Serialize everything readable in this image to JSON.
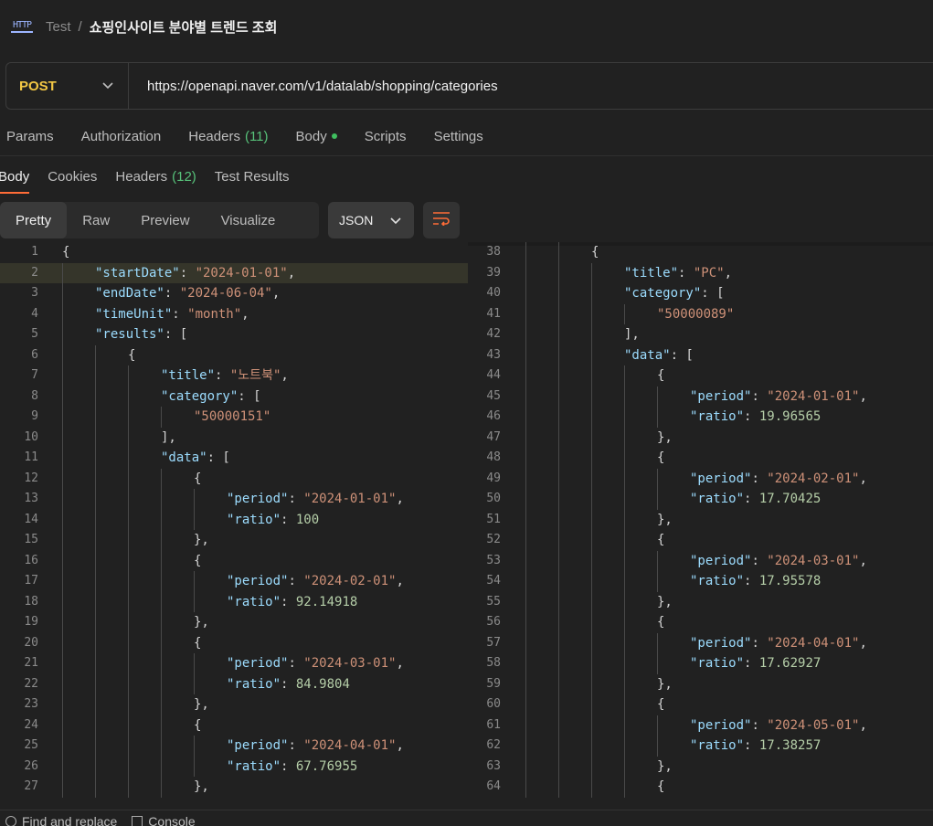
{
  "breadcrumb": {
    "parent": "Test",
    "separator": "/",
    "title": "쇼핑인사이트 분야별 트렌드 조회"
  },
  "request": {
    "method": "POST",
    "url": "https://openapi.naver.com/v1/datalab/shopping/categories"
  },
  "request_tabs": [
    {
      "label": "Params"
    },
    {
      "label": "Authorization"
    },
    {
      "label": "Headers",
      "count": "(11)"
    },
    {
      "label": "Body",
      "dot": true
    },
    {
      "label": "Scripts"
    },
    {
      "label": "Settings"
    }
  ],
  "response_tabs": [
    {
      "label": "Body",
      "active": true
    },
    {
      "label": "Cookies"
    },
    {
      "label": "Headers",
      "count": "(12)"
    },
    {
      "label": "Test Results"
    }
  ],
  "view_modes": [
    {
      "label": "Pretty",
      "active": true
    },
    {
      "label": "Raw"
    },
    {
      "label": "Preview"
    },
    {
      "label": "Visualize"
    }
  ],
  "format": "JSON",
  "colors": {
    "accent": "#ff6c37",
    "method": "#f2c744",
    "key": "#9cdcfe",
    "string": "#ce9178",
    "number": "#b5cea8"
  },
  "code_left": [
    {
      "n": "1",
      "indent": 0,
      "t": [
        [
          "p",
          "{"
        ]
      ]
    },
    {
      "n": "2",
      "indent": 1,
      "hl": true,
      "t": [
        [
          "k",
          "\"startDate\""
        ],
        [
          "p",
          ": "
        ],
        [
          "s",
          "\"2024-01-01\""
        ],
        [
          "p",
          ","
        ]
      ]
    },
    {
      "n": "3",
      "indent": 1,
      "t": [
        [
          "k",
          "\"endDate\""
        ],
        [
          "p",
          ": "
        ],
        [
          "s",
          "\"2024-06-04\""
        ],
        [
          "p",
          ","
        ]
      ]
    },
    {
      "n": "4",
      "indent": 1,
      "t": [
        [
          "k",
          "\"timeUnit\""
        ],
        [
          "p",
          ": "
        ],
        [
          "s",
          "\"month\""
        ],
        [
          "p",
          ","
        ]
      ]
    },
    {
      "n": "5",
      "indent": 1,
      "t": [
        [
          "k",
          "\"results\""
        ],
        [
          "p",
          ": ["
        ]
      ]
    },
    {
      "n": "6",
      "indent": 2,
      "t": [
        [
          "p",
          "{"
        ]
      ]
    },
    {
      "n": "7",
      "indent": 3,
      "t": [
        [
          "k",
          "\"title\""
        ],
        [
          "p",
          ": "
        ],
        [
          "s",
          "\"노트북\""
        ],
        [
          "p",
          ","
        ]
      ]
    },
    {
      "n": "8",
      "indent": 3,
      "t": [
        [
          "k",
          "\"category\""
        ],
        [
          "p",
          ": ["
        ]
      ]
    },
    {
      "n": "9",
      "indent": 4,
      "t": [
        [
          "s",
          "\"50000151\""
        ]
      ]
    },
    {
      "n": "10",
      "indent": 3,
      "t": [
        [
          "p",
          "],"
        ]
      ]
    },
    {
      "n": "11",
      "indent": 3,
      "t": [
        [
          "k",
          "\"data\""
        ],
        [
          "p",
          ": ["
        ]
      ]
    },
    {
      "n": "12",
      "indent": 4,
      "t": [
        [
          "p",
          "{"
        ]
      ]
    },
    {
      "n": "13",
      "indent": 5,
      "t": [
        [
          "k",
          "\"period\""
        ],
        [
          "p",
          ": "
        ],
        [
          "s",
          "\"2024-01-01\""
        ],
        [
          "p",
          ","
        ]
      ]
    },
    {
      "n": "14",
      "indent": 5,
      "t": [
        [
          "k",
          "\"ratio\""
        ],
        [
          "p",
          ": "
        ],
        [
          "n",
          "100"
        ]
      ]
    },
    {
      "n": "15",
      "indent": 4,
      "t": [
        [
          "p",
          "},"
        ]
      ]
    },
    {
      "n": "16",
      "indent": 4,
      "t": [
        [
          "p",
          "{"
        ]
      ]
    },
    {
      "n": "17",
      "indent": 5,
      "t": [
        [
          "k",
          "\"period\""
        ],
        [
          "p",
          ": "
        ],
        [
          "s",
          "\"2024-02-01\""
        ],
        [
          "p",
          ","
        ]
      ]
    },
    {
      "n": "18",
      "indent": 5,
      "t": [
        [
          "k",
          "\"ratio\""
        ],
        [
          "p",
          ": "
        ],
        [
          "n",
          "92.14918"
        ]
      ]
    },
    {
      "n": "19",
      "indent": 4,
      "t": [
        [
          "p",
          "},"
        ]
      ]
    },
    {
      "n": "20",
      "indent": 4,
      "t": [
        [
          "p",
          "{"
        ]
      ]
    },
    {
      "n": "21",
      "indent": 5,
      "t": [
        [
          "k",
          "\"period\""
        ],
        [
          "p",
          ": "
        ],
        [
          "s",
          "\"2024-03-01\""
        ],
        [
          "p",
          ","
        ]
      ]
    },
    {
      "n": "22",
      "indent": 5,
      "t": [
        [
          "k",
          "\"ratio\""
        ],
        [
          "p",
          ": "
        ],
        [
          "n",
          "84.9804"
        ]
      ]
    },
    {
      "n": "23",
      "indent": 4,
      "t": [
        [
          "p",
          "},"
        ]
      ]
    },
    {
      "n": "24",
      "indent": 4,
      "t": [
        [
          "p",
          "{"
        ]
      ]
    },
    {
      "n": "25",
      "indent": 5,
      "t": [
        [
          "k",
          "\"period\""
        ],
        [
          "p",
          ": "
        ],
        [
          "s",
          "\"2024-04-01\""
        ],
        [
          "p",
          ","
        ]
      ]
    },
    {
      "n": "26",
      "indent": 5,
      "t": [
        [
          "k",
          "\"ratio\""
        ],
        [
          "p",
          ": "
        ],
        [
          "n",
          "67.76955"
        ]
      ]
    },
    {
      "n": "27",
      "indent": 4,
      "t": [
        [
          "p",
          "},"
        ]
      ]
    }
  ],
  "code_right": [
    {
      "n": "38",
      "indent": 2,
      "t": [
        [
          "p",
          "{"
        ]
      ]
    },
    {
      "n": "39",
      "indent": 3,
      "t": [
        [
          "k",
          "\"title\""
        ],
        [
          "p",
          ": "
        ],
        [
          "s",
          "\"PC\""
        ],
        [
          "p",
          ","
        ]
      ]
    },
    {
      "n": "40",
      "indent": 3,
      "t": [
        [
          "k",
          "\"category\""
        ],
        [
          "p",
          ": ["
        ]
      ]
    },
    {
      "n": "41",
      "indent": 4,
      "t": [
        [
          "s",
          "\"50000089\""
        ]
      ]
    },
    {
      "n": "42",
      "indent": 3,
      "t": [
        [
          "p",
          "],"
        ]
      ]
    },
    {
      "n": "43",
      "indent": 3,
      "t": [
        [
          "k",
          "\"data\""
        ],
        [
          "p",
          ": ["
        ]
      ]
    },
    {
      "n": "44",
      "indent": 4,
      "t": [
        [
          "p",
          "{"
        ]
      ]
    },
    {
      "n": "45",
      "indent": 5,
      "t": [
        [
          "k",
          "\"period\""
        ],
        [
          "p",
          ": "
        ],
        [
          "s",
          "\"2024-01-01\""
        ],
        [
          "p",
          ","
        ]
      ]
    },
    {
      "n": "46",
      "indent": 5,
      "t": [
        [
          "k",
          "\"ratio\""
        ],
        [
          "p",
          ": "
        ],
        [
          "n",
          "19.96565"
        ]
      ]
    },
    {
      "n": "47",
      "indent": 4,
      "t": [
        [
          "p",
          "},"
        ]
      ]
    },
    {
      "n": "48",
      "indent": 4,
      "t": [
        [
          "p",
          "{"
        ]
      ]
    },
    {
      "n": "49",
      "indent": 5,
      "t": [
        [
          "k",
          "\"period\""
        ],
        [
          "p",
          ": "
        ],
        [
          "s",
          "\"2024-02-01\""
        ],
        [
          "p",
          ","
        ]
      ]
    },
    {
      "n": "50",
      "indent": 5,
      "t": [
        [
          "k",
          "\"ratio\""
        ],
        [
          "p",
          ": "
        ],
        [
          "n",
          "17.70425"
        ]
      ]
    },
    {
      "n": "51",
      "indent": 4,
      "t": [
        [
          "p",
          "},"
        ]
      ]
    },
    {
      "n": "52",
      "indent": 4,
      "t": [
        [
          "p",
          "{"
        ]
      ]
    },
    {
      "n": "53",
      "indent": 5,
      "t": [
        [
          "k",
          "\"period\""
        ],
        [
          "p",
          ": "
        ],
        [
          "s",
          "\"2024-03-01\""
        ],
        [
          "p",
          ","
        ]
      ]
    },
    {
      "n": "54",
      "indent": 5,
      "t": [
        [
          "k",
          "\"ratio\""
        ],
        [
          "p",
          ": "
        ],
        [
          "n",
          "17.95578"
        ]
      ]
    },
    {
      "n": "55",
      "indent": 4,
      "t": [
        [
          "p",
          "},"
        ]
      ]
    },
    {
      "n": "56",
      "indent": 4,
      "t": [
        [
          "p",
          "{"
        ]
      ]
    },
    {
      "n": "57",
      "indent": 5,
      "t": [
        [
          "k",
          "\"period\""
        ],
        [
          "p",
          ": "
        ],
        [
          "s",
          "\"2024-04-01\""
        ],
        [
          "p",
          ","
        ]
      ]
    },
    {
      "n": "58",
      "indent": 5,
      "t": [
        [
          "k",
          "\"ratio\""
        ],
        [
          "p",
          ": "
        ],
        [
          "n",
          "17.62927"
        ]
      ]
    },
    {
      "n": "59",
      "indent": 4,
      "t": [
        [
          "p",
          "},"
        ]
      ]
    },
    {
      "n": "60",
      "indent": 4,
      "t": [
        [
          "p",
          "{"
        ]
      ]
    },
    {
      "n": "61",
      "indent": 5,
      "t": [
        [
          "k",
          "\"period\""
        ],
        [
          "p",
          ": "
        ],
        [
          "s",
          "\"2024-05-01\""
        ],
        [
          "p",
          ","
        ]
      ]
    },
    {
      "n": "62",
      "indent": 5,
      "t": [
        [
          "k",
          "\"ratio\""
        ],
        [
          "p",
          ": "
        ],
        [
          "n",
          "17.38257"
        ]
      ]
    },
    {
      "n": "63",
      "indent": 4,
      "t": [
        [
          "p",
          "},"
        ]
      ]
    },
    {
      "n": "64",
      "indent": 4,
      "t": [
        [
          "p",
          "{"
        ]
      ]
    }
  ],
  "footer": {
    "find_replace": "Find and replace",
    "console": "Console"
  }
}
